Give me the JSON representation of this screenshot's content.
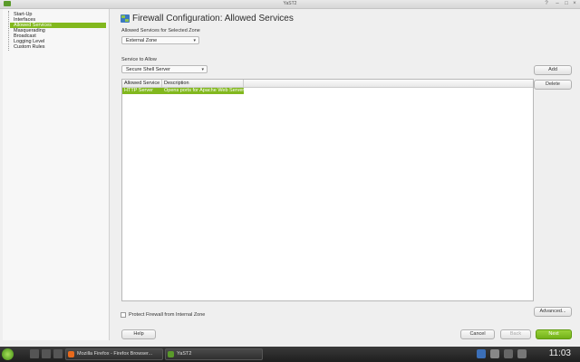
{
  "window": {
    "title": "YaST2"
  },
  "nav": {
    "items": [
      "Start-Up",
      "Interfaces",
      "Allowed Services",
      "Masquerading",
      "Broadcast",
      "Logging Level",
      "Custom Rules"
    ],
    "selected_index": 2
  },
  "page": {
    "title": "Firewall Configuration: Allowed Services"
  },
  "zone": {
    "label": "Allowed Services for Selected Zone",
    "value": "External Zone"
  },
  "service": {
    "label": "Service to Allow",
    "value": "Secure Shell Server"
  },
  "buttons": {
    "add": "Add",
    "delete": "Delete",
    "advanced": "Advanced...",
    "help": "Help",
    "cancel": "Cancel",
    "back": "Back",
    "next": "Next"
  },
  "table": {
    "columns": [
      "Allowed Service",
      "Description"
    ],
    "rows": [
      {
        "service": "HTTP Server",
        "description": "Opens ports for Apache Web Server"
      }
    ]
  },
  "protect": {
    "label": "Protect Firewall from Internal Zone",
    "checked": false
  },
  "taskbar": {
    "tasks": [
      "Mozilla Firefox - Firefox Browser...",
      "YaST2"
    ],
    "clock": "11:03"
  },
  "colors": {
    "accent": "#82b81e",
    "primary_button": "#72b018",
    "taskbar": "#2a2a2a"
  }
}
